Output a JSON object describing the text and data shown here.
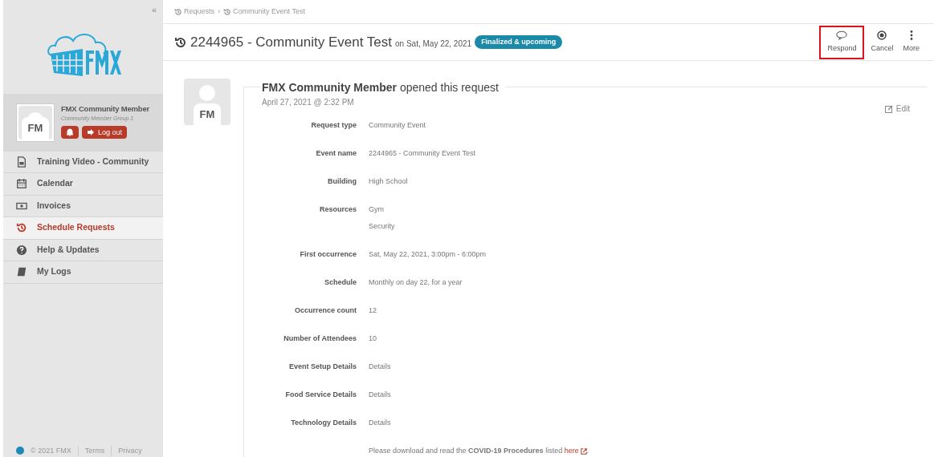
{
  "sidebar": {
    "collapse": "«",
    "user": {
      "name": "FMX Community Member",
      "group": "Community Member Group 1",
      "initials": "FM",
      "logout": "Log out"
    },
    "items": [
      {
        "label": "Training Video - Community",
        "kind": "video",
        "selected": false
      },
      {
        "label": "Calendar",
        "kind": "calendar",
        "selected": false
      },
      {
        "label": "Invoices",
        "kind": "money",
        "selected": false
      },
      {
        "label": "Schedule Requests",
        "kind": "history",
        "selected": true
      },
      {
        "label": "Help & Updates",
        "kind": "help",
        "selected": false
      },
      {
        "label": "My Logs",
        "kind": "book",
        "selected": false
      }
    ],
    "footer": [
      "© 2021 FMX",
      "Terms",
      "Privacy"
    ]
  },
  "breadcrumb": {
    "separator": "›",
    "items": [
      "Requests",
      "Community Event Test"
    ]
  },
  "header": {
    "title": "2244965 - Community Event Test",
    "date": "on Sat, May 22, 2021",
    "badge": "Finalized & upcoming",
    "actions": [
      {
        "label": "Respond",
        "kind": "comment",
        "highlighted": true
      },
      {
        "label": "Cancel",
        "kind": "cancel",
        "highlighted": false
      },
      {
        "label": "More",
        "kind": "more",
        "highlighted": false
      }
    ]
  },
  "request": {
    "initials": "FM",
    "author": "FMX Community Member",
    "action": "opened this request",
    "time": "April 27, 2021 @ 2:32 PM",
    "edit": "Edit",
    "fields": [
      {
        "label": "Request type",
        "values": [
          "Community Event"
        ]
      },
      {
        "label": "Event name",
        "values": [
          "2244965 - Community Event Test"
        ]
      },
      {
        "label": "Building",
        "values": [
          "High School"
        ]
      },
      {
        "label": "Resources",
        "values": [
          "Gym",
          "Security"
        ]
      },
      {
        "label": "First occurrence",
        "values": [
          "Sat, May 22, 2021, 3:00pm - 6:00pm"
        ]
      },
      {
        "label": "Schedule",
        "values": [
          "Monthly on day 22, for a year"
        ]
      },
      {
        "label": "Occurrence count",
        "values": [
          "12"
        ]
      },
      {
        "label": "Number of Attendees",
        "values": [
          "10"
        ]
      },
      {
        "label": "Event Setup Details",
        "values": [
          "Details"
        ]
      },
      {
        "label": "Food Service Details",
        "values": [
          "Details"
        ]
      },
      {
        "label": "Technology Details",
        "values": [
          "Details"
        ]
      }
    ],
    "note": "Please download and read the **COVID-19 Procedures** listed",
    "note_link": "here",
    "note_end": "."
  }
}
